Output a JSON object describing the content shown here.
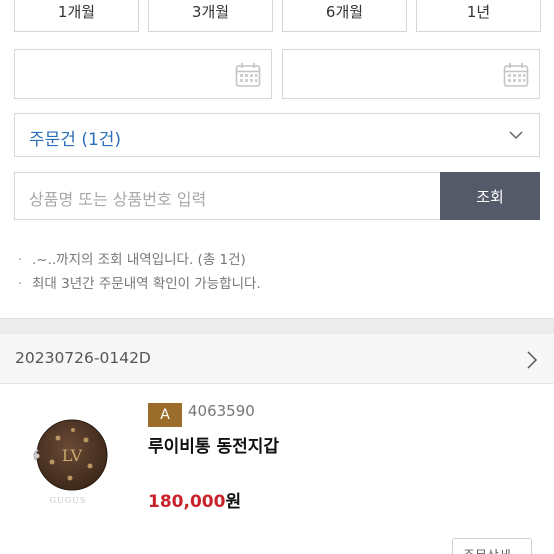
{
  "period_buttons": [
    {
      "label": "1개월"
    },
    {
      "label": "3개월"
    },
    {
      "label": "6개월"
    },
    {
      "label": "1년"
    }
  ],
  "order_filter": {
    "selected": "주문건 (1건)"
  },
  "search": {
    "placeholder": "상품명 또는 상품번호 입력",
    "button_label": "조회"
  },
  "notes": [
    ".~..까지의 조회 내역입니다. (총 1건)",
    "최대 3년간 주문내역 확인이 가능합니다."
  ],
  "order": {
    "order_number": "20230726-0142D",
    "product": {
      "grade": "A",
      "code": "4063590",
      "name": "루이비통 동전지갑",
      "price": "180,000",
      "price_unit": "원"
    },
    "detail_button_label": "주문상세"
  },
  "colors": {
    "accent": "#2c6eb5",
    "button_dark": "#545a68",
    "price_red": "#c8232c",
    "badge": "#9b6d2b"
  }
}
